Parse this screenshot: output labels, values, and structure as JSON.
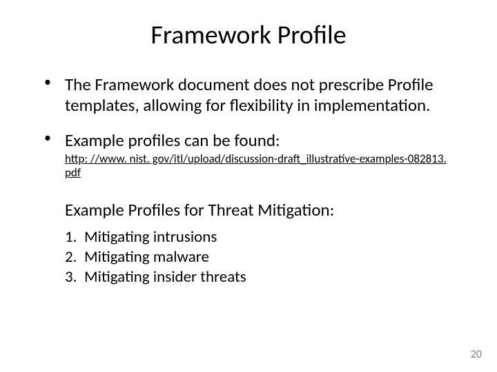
{
  "title": "Framework Profile",
  "bullets": [
    "The Framework document does not prescribe Profile templates, allowing for flexibility in implementation.",
    "Example profiles can be found:"
  ],
  "link": "http: //www. nist. gov/itl/upload/discussion-draft_illustrative-examples-082813. pdf",
  "subhead": "Example Profiles for Threat Mitigation:",
  "numbered": [
    "Mitigating intrusions",
    "Mitigating malware",
    "Mitigating insider threats"
  ],
  "page": "20"
}
